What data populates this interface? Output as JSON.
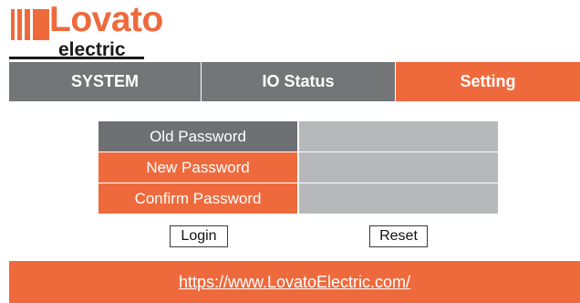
{
  "logo": {
    "brand": "Lovato",
    "sub": "electric"
  },
  "nav": {
    "tabs": [
      {
        "label": "SYSTEM"
      },
      {
        "label": "IO Status"
      },
      {
        "label": "Setting",
        "active": true
      }
    ]
  },
  "form": {
    "old_password_label": "Old Password",
    "new_password_label": "New Password",
    "confirm_password_label": "Confirm Password",
    "old_password_value": "",
    "new_password_value": "",
    "confirm_password_value": ""
  },
  "buttons": {
    "login": "Login",
    "reset": "Reset"
  },
  "footer": {
    "link": "https://www.LovatoElectric.com/"
  },
  "colors": {
    "accent": "#ee6a3d",
    "tab_gray": "#747577",
    "input_gray": "#b7b8ba"
  }
}
